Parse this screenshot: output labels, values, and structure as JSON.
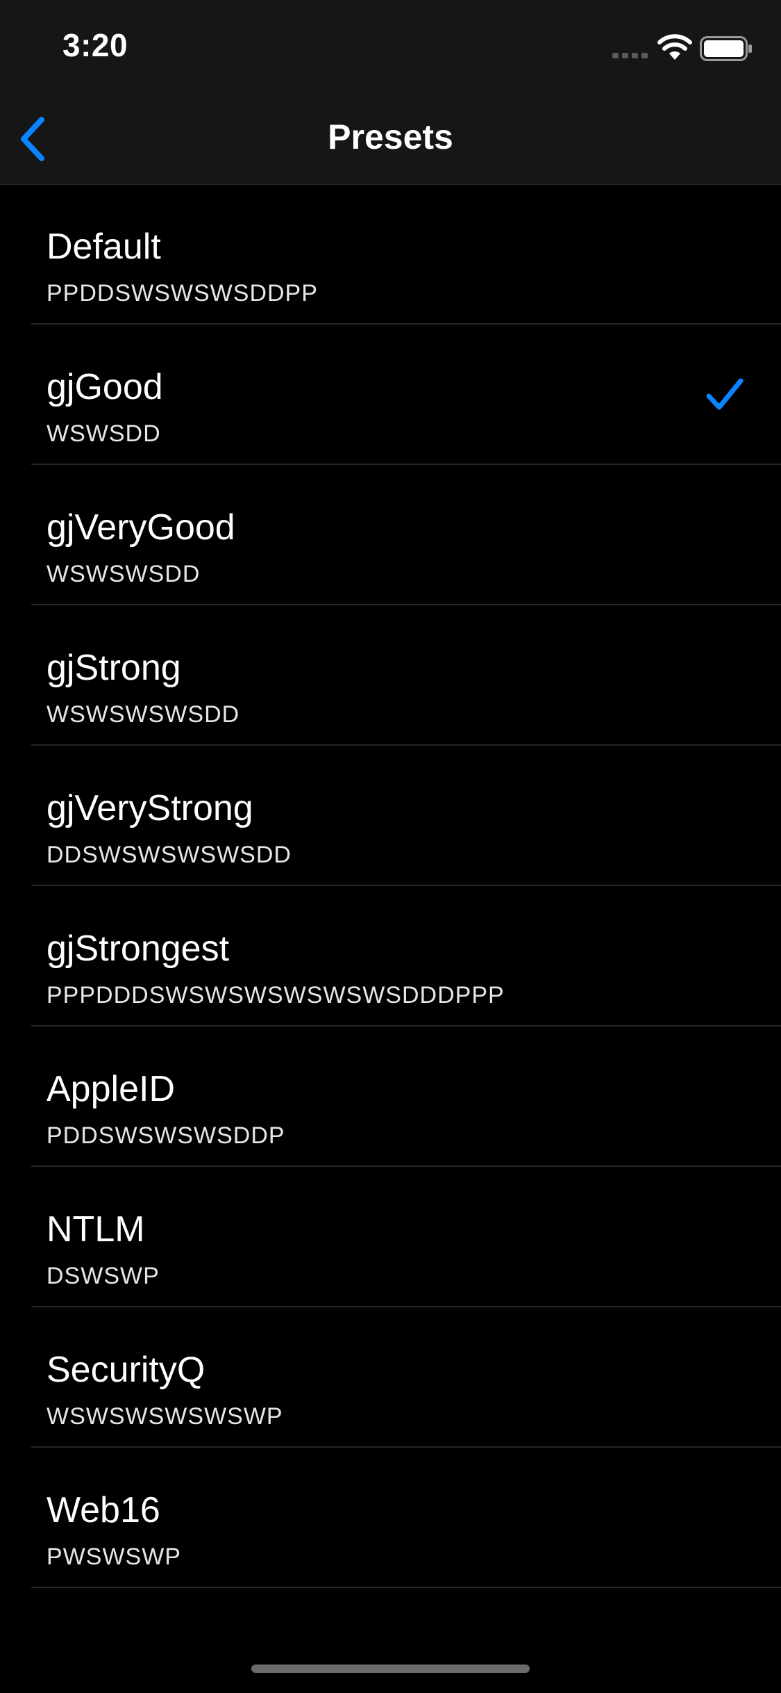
{
  "status_bar": {
    "time": "3:20"
  },
  "nav": {
    "title": "Presets",
    "back_icon": "chevron-left-icon"
  },
  "colors": {
    "accent": "#0a84ff",
    "background": "#000000",
    "bar": "#161616"
  },
  "presets": [
    {
      "name": "Default",
      "pattern": "PPDDSWSWSWSDDPP",
      "selected": false
    },
    {
      "name": "gjGood",
      "pattern": "WSWSDD",
      "selected": true
    },
    {
      "name": "gjVeryGood",
      "pattern": "WSWSWSDD",
      "selected": false
    },
    {
      "name": "gjStrong",
      "pattern": "WSWSWSWSDD",
      "selected": false
    },
    {
      "name": "gjVeryStrong",
      "pattern": "DDSWSWSWSWSDD",
      "selected": false
    },
    {
      "name": "gjStrongest",
      "pattern": "PPPDDDSWSWSWSWSWSWSDDDPPP",
      "selected": false
    },
    {
      "name": "AppleID",
      "pattern": "PDDSWSWSWSDDP",
      "selected": false
    },
    {
      "name": "NTLM",
      "pattern": "DSWSWP",
      "selected": false
    },
    {
      "name": "SecurityQ",
      "pattern": "WSWSWSWSWSWP",
      "selected": false
    },
    {
      "name": "Web16",
      "pattern": "PWSWSWP",
      "selected": false
    }
  ]
}
